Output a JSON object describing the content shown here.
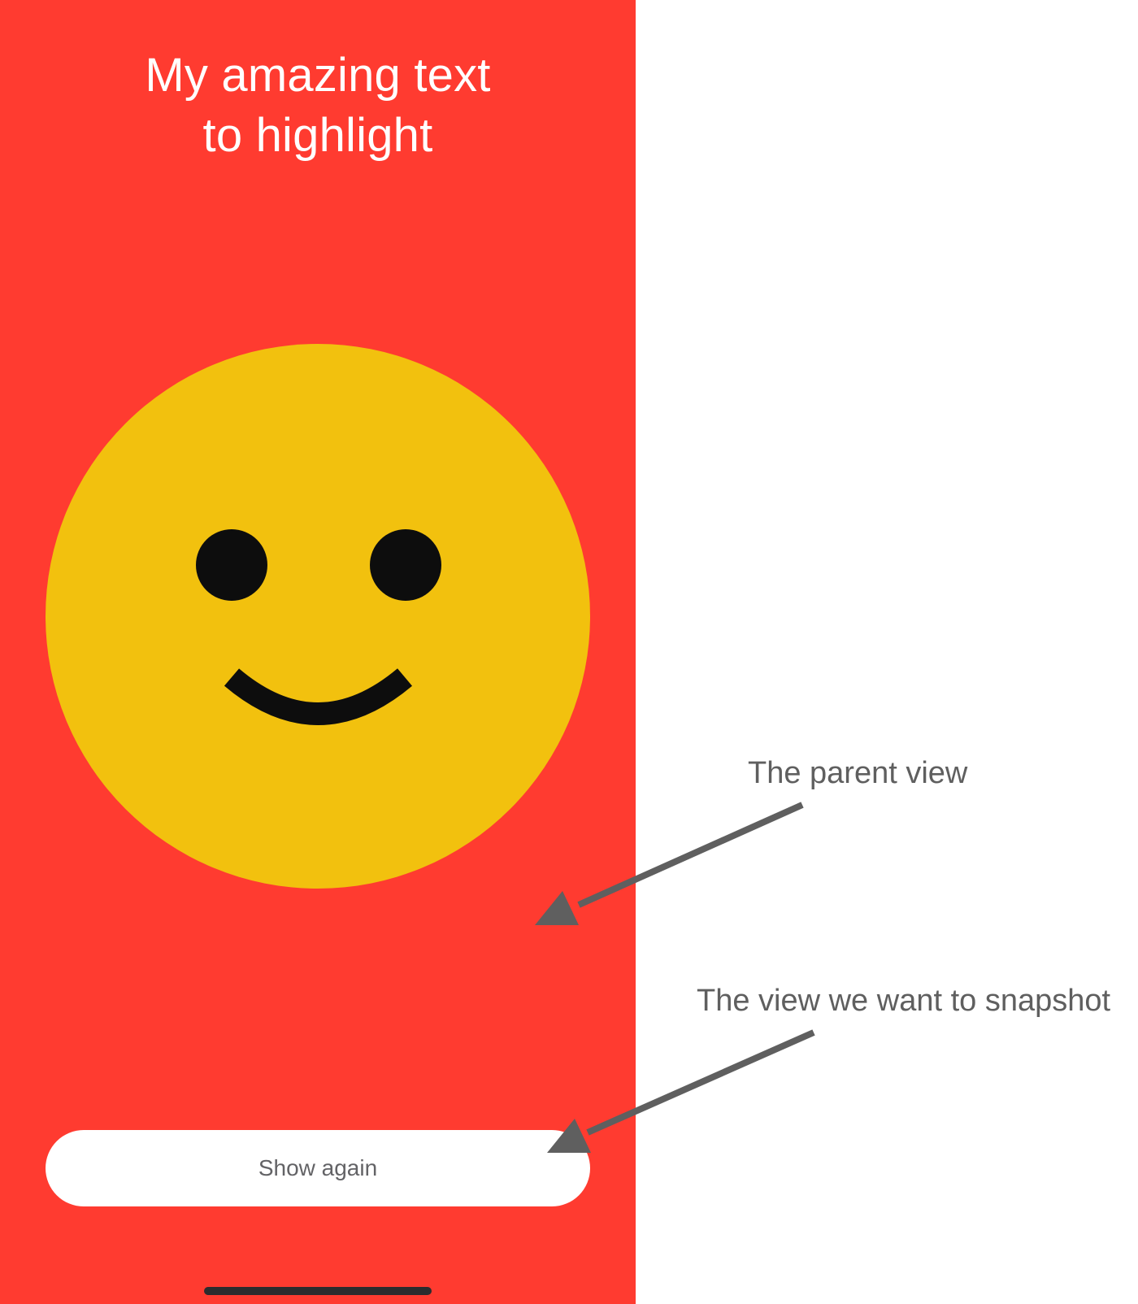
{
  "screen": {
    "background_color": "#ff3b30",
    "headline_lines": [
      "My amazing text",
      "to highlight"
    ],
    "emoji": "smiling-face-icon",
    "emoji_color": "#f2c10e",
    "button_label": "Show again"
  },
  "annotations": {
    "parent_view_label": "The parent view",
    "snapshot_view_label": "The view we want to snapshot",
    "arrow_color": "#5f5f5f"
  }
}
